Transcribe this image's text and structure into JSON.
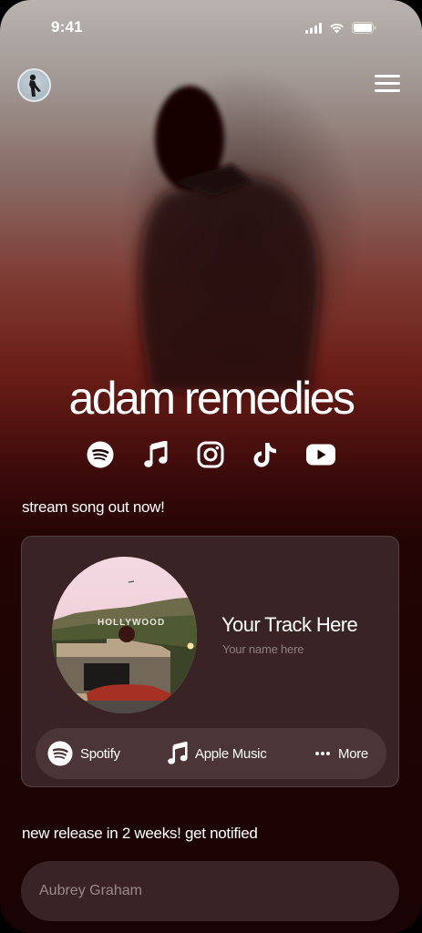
{
  "status_bar": {
    "time": "9:41"
  },
  "header": {
    "avatar_icon": "artist-avatar",
    "menu_icon": "hamburger-menu-icon"
  },
  "artist": {
    "name": "adam remedies"
  },
  "socials": [
    {
      "name": "spotify-icon"
    },
    {
      "name": "music-note-icon"
    },
    {
      "name": "instagram-icon"
    },
    {
      "name": "tiktok-icon"
    },
    {
      "name": "youtube-icon"
    }
  ],
  "stream_section": {
    "label": "stream song out now!"
  },
  "track_card": {
    "cover_sign_text": "HOLLYWOOD",
    "title": "Your Track Here",
    "artist": "Your name here",
    "platforms": [
      {
        "label": "Spotify",
        "icon": "spotify-icon"
      },
      {
        "label": "Apple Music",
        "icon": "music-note-icon"
      },
      {
        "label": "More",
        "icon": "ellipsis-icon"
      }
    ]
  },
  "notify_section": {
    "label": "new release in 2 weeks! get notified",
    "input_placeholder": "Aubrey Graham"
  },
  "colors": {
    "card": "#3a2324",
    "platform_bar": "#4b3536",
    "background_dark": "#1a0304"
  }
}
